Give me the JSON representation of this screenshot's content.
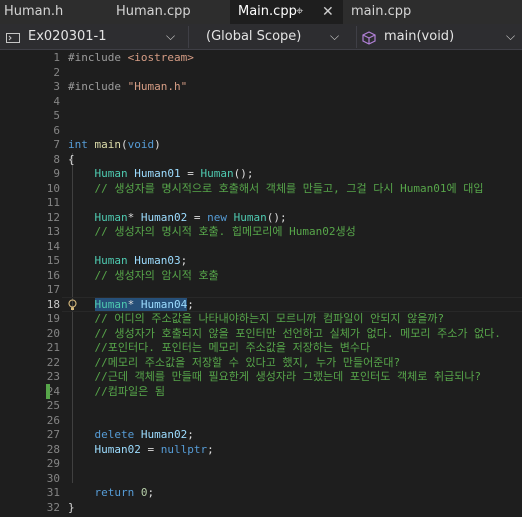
{
  "tabs": [
    {
      "label": "Human.h",
      "active": false
    },
    {
      "label": "Human.cpp",
      "active": false
    },
    {
      "label": "Main.cpp",
      "active": true
    },
    {
      "label": "main.cpp",
      "active": false
    }
  ],
  "nav": {
    "project": "Ex020301-1",
    "scope": "(Global Scope)",
    "member": "main(void)"
  },
  "editor": {
    "current_line": 18,
    "lines": [
      {
        "n": "1",
        "segs": [
          [
            "pp",
            "#include "
          ],
          [
            "st",
            "<iostream>"
          ]
        ]
      },
      {
        "n": "2",
        "segs": []
      },
      {
        "n": "3",
        "segs": [
          [
            "pp",
            "#include "
          ],
          [
            "st",
            "\"Human.h\""
          ]
        ]
      },
      {
        "n": "4",
        "segs": []
      },
      {
        "n": "5",
        "segs": []
      },
      {
        "n": "6",
        "segs": []
      },
      {
        "n": "7",
        "segs": [
          [
            "kw",
            "int "
          ],
          [
            "fn",
            "main"
          ],
          [
            "pl",
            "("
          ],
          [
            "kw",
            "void"
          ],
          [
            "pl",
            ")"
          ]
        ]
      },
      {
        "n": "8",
        "segs": [
          [
            "pl",
            "{"
          ]
        ]
      },
      {
        "n": "9",
        "segs": [
          [
            "pl",
            "    "
          ],
          [
            "ty",
            "Human "
          ],
          [
            "vr",
            "Human01"
          ],
          [
            "pl",
            " = "
          ],
          [
            "ty",
            "Human"
          ],
          [
            "pl",
            "();"
          ]
        ]
      },
      {
        "n": "10",
        "segs": [
          [
            "cmt",
            "    // 생성자를 명시적으로 호출해서 객체를 만들고, 그걸 다시 Human01에 대입"
          ]
        ]
      },
      {
        "n": "11",
        "segs": []
      },
      {
        "n": "12",
        "segs": [
          [
            "pl",
            "    "
          ],
          [
            "ty",
            "Human"
          ],
          [
            "pl",
            "* "
          ],
          [
            "vr",
            "Human02"
          ],
          [
            "pl",
            " = "
          ],
          [
            "kw",
            "new "
          ],
          [
            "ty",
            "Human"
          ],
          [
            "pl",
            "();"
          ]
        ]
      },
      {
        "n": "13",
        "segs": [
          [
            "cmt",
            "    // 생성자의 명시적 호출. 힙메모리에 Human02생성"
          ]
        ]
      },
      {
        "n": "14",
        "segs": []
      },
      {
        "n": "15",
        "segs": [
          [
            "pl",
            "    "
          ],
          [
            "ty",
            "Human "
          ],
          [
            "vr",
            "Human03"
          ],
          [
            "pl",
            ";"
          ]
        ]
      },
      {
        "n": "16",
        "segs": [
          [
            "cmt",
            "    // 생성자의 암시적 호출"
          ]
        ]
      },
      {
        "n": "17",
        "segs": []
      },
      {
        "n": "18",
        "segs": [
          [
            "pl",
            "    "
          ],
          [
            "ty sel",
            "Human"
          ],
          [
            "pl sel",
            "* "
          ],
          [
            "vr sel",
            "Human04"
          ],
          [
            "pl",
            ";"
          ]
        ]
      },
      {
        "n": "19",
        "segs": [
          [
            "cmt",
            "    // 어디의 주소값을 나타내야하는지 모르니까 컴파일이 안되지 않을까?"
          ]
        ]
      },
      {
        "n": "20",
        "segs": [
          [
            "cmt",
            "    // 생성자가 호출되지 않을 포인터만 선언하고 실체가 없다. 메모리 주소가 없다."
          ]
        ]
      },
      {
        "n": "21",
        "segs": [
          [
            "cmt",
            "    //포인터다. 포인터는 메모리 주소값을 저장하는 변수다"
          ]
        ]
      },
      {
        "n": "22",
        "segs": [
          [
            "cmt",
            "    //메모리 주소값을 저장할 수 있다고 했지, 누가 만들어준대?"
          ]
        ]
      },
      {
        "n": "23",
        "segs": [
          [
            "cmt",
            "    //근데 객체를 만들때 필요한게 생성자라 그랬는데 포인터도 객체로 취급되나?"
          ]
        ]
      },
      {
        "n": "24",
        "segs": [
          [
            "cmt",
            "    //컴파일은 됨"
          ]
        ]
      },
      {
        "n": "25",
        "segs": []
      },
      {
        "n": "26",
        "segs": []
      },
      {
        "n": "27",
        "segs": [
          [
            "pl",
            "    "
          ],
          [
            "kw",
            "delete "
          ],
          [
            "vr",
            "Human02"
          ],
          [
            "pl",
            ";"
          ]
        ]
      },
      {
        "n": "28",
        "segs": [
          [
            "pl",
            "    "
          ],
          [
            "vr",
            "Human02"
          ],
          [
            "pl",
            " = "
          ],
          [
            "kw",
            "nullptr"
          ],
          [
            "pl",
            ";"
          ]
        ]
      },
      {
        "n": "29",
        "segs": []
      },
      {
        "n": "30",
        "segs": []
      },
      {
        "n": "31",
        "segs": [
          [
            "pl",
            "    "
          ],
          [
            "kw",
            "return "
          ],
          [
            "nm",
            "0"
          ],
          [
            "pl",
            ";"
          ]
        ]
      },
      {
        "n": "32",
        "segs": [
          [
            "pl",
            "}"
          ]
        ]
      }
    ]
  },
  "colors": {
    "editor_bg": "#1e1e1e",
    "comment": "#57a64a",
    "keyword": "#569cd6",
    "type": "#4ec9b0",
    "variable": "#9cdcfe",
    "selection": "#264f78"
  }
}
